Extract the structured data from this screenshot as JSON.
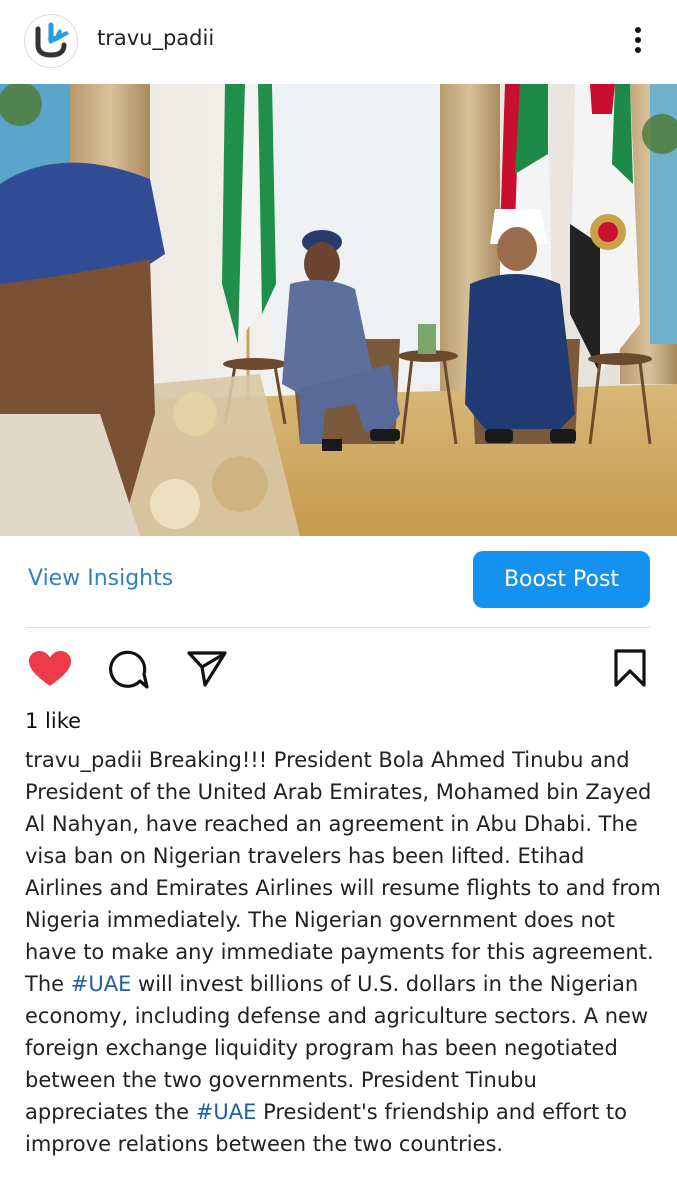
{
  "post": {
    "username": "travu_padii",
    "photo_alt": "President Bola Ahmed Tinubu meets President Mohamed bin Zayed Al Nahyan in Abu Dhabi"
  },
  "actions": {
    "view_insights": "View Insights",
    "boost_post": "Boost Post",
    "likes": "1 like",
    "liked": true
  },
  "caption": {
    "username": "travu_padii",
    "seg1": "Breaking!!! President Bola Ahmed Tinubu and President of the United Arab Emirates, Mohamed bin Zayed Al Nahyan, have reached an agreement in Abu Dhabi. The visa ban on Nigerian travelers has been lifted. Etihad Airlines and Emirates Airlines will resume flights to and from Nigeria immediately. The Nigerian government does not have to make any immediate payments for this agreement. The ",
    "tag1": "#UAE",
    "seg2": " will invest billions of U.S. dollars in the Nigerian economy, including defense and agriculture sectors. A new foreign exchange liquidity program has been negotiated between the two governments. President Tinubu appreciates the ",
    "tag2": "#UAE",
    "seg3": " President's friendship and effort to improve relations between the two countries."
  },
  "colors": {
    "accent": "#1592ef",
    "link": "#2f80c5",
    "hashtag": "#1f5ea8",
    "heart": "#ed3b4a"
  },
  "icons": [
    "logo-icon",
    "more-vertical-icon",
    "heart-icon",
    "comment-icon",
    "share-icon",
    "bookmark-icon"
  ]
}
